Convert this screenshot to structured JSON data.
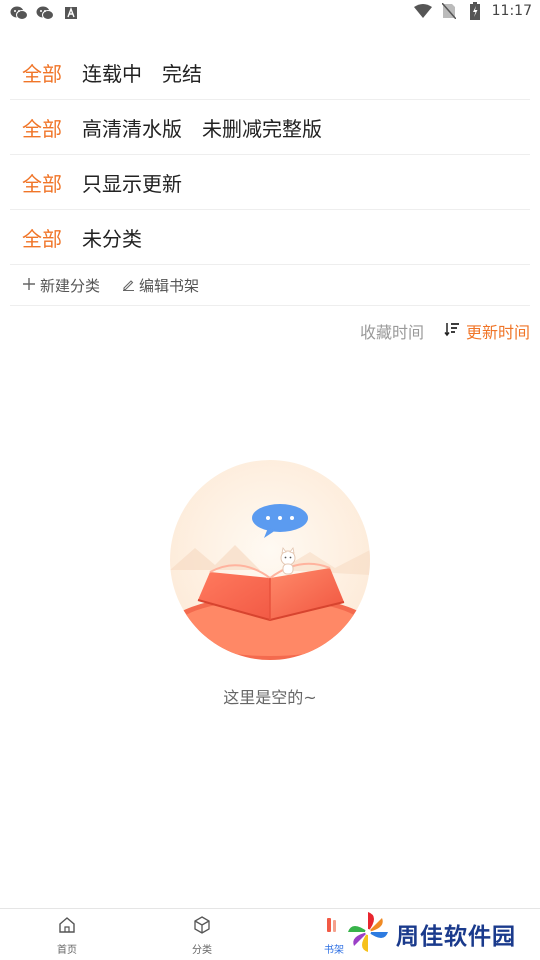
{
  "status_bar": {
    "left_icons": [
      "wechat-icon",
      "wechat-icon",
      "font-app-icon"
    ],
    "right_icons": [
      "wifi-icon",
      "no-sim-icon",
      "battery-charging-icon"
    ],
    "time": "11:17"
  },
  "filters": [
    {
      "all": "全部",
      "options": [
        "连载中",
        "完结"
      ]
    },
    {
      "all": "全部",
      "options": [
        "高清清水版",
        "未删减完整版"
      ]
    },
    {
      "all": "全部",
      "options": [
        "只显示更新"
      ]
    },
    {
      "all": "全部",
      "options": [
        "未分类"
      ]
    }
  ],
  "tools": {
    "new_category_icon": "plus-icon",
    "new_category": "新建分类",
    "edit_shelf_icon": "pencil-icon",
    "edit_shelf": "编辑书架"
  },
  "sort": {
    "by_favorite": "收藏时间",
    "by_update": "更新时间",
    "active": "by_update",
    "sort_icon": "sort-desc-icon"
  },
  "empty_state": {
    "illustration": "open-book-illustration",
    "text": "这里是空的~"
  },
  "bottom_nav": [
    {
      "icon": "home-icon",
      "label": "首页"
    },
    {
      "icon": "cube-icon",
      "label": "分类"
    },
    {
      "icon": "bookshelf-icon",
      "label": "书架",
      "active": true
    }
  ],
  "watermark": {
    "text": "周佳软件园",
    "logo": "pinwheel-logo"
  },
  "colors": {
    "accent": "#f07528",
    "active_nav": "#2d6fe3",
    "muted": "#9a9a9a"
  }
}
